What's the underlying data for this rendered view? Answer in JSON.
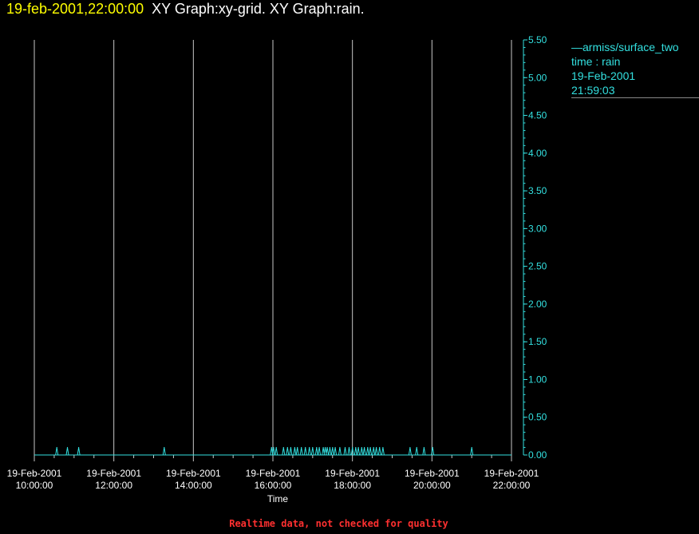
{
  "header": {
    "timestamp": "19-feb-2001,22:00:00",
    "graph_titles": "XY Graph:xy-grid.  XY Graph:rain."
  },
  "legend": {
    "series": "armiss/surface_two",
    "variable": "time : rain",
    "date": "19-Feb-2001",
    "time": "21:59:03"
  },
  "footer": "Realtime data, not checked for quality",
  "colors": {
    "series": "#33e0e0",
    "grid": "#c8c8c8",
    "axis_text": "#ffffff",
    "timestamp": "#ffff00",
    "footer": "#ff3030"
  },
  "chart_data": {
    "type": "line",
    "title": "",
    "xlabel": "Time",
    "ylabel": "",
    "x_range_hours": [
      10,
      22
    ],
    "ylim": [
      0,
      5.5
    ],
    "x_ticks": [
      {
        "hour": 10,
        "date": "19-Feb-2001",
        "time": "10:00:00"
      },
      {
        "hour": 12,
        "date": "19-Feb-2001",
        "time": "12:00:00"
      },
      {
        "hour": 14,
        "date": "19-Feb-2001",
        "time": "14:00:00"
      },
      {
        "hour": 16,
        "date": "19-Feb-2001",
        "time": "16:00:00"
      },
      {
        "hour": 18,
        "date": "19-Feb-2001",
        "time": "18:00:00"
      },
      {
        "hour": 20,
        "date": "19-Feb-2001",
        "time": "20:00:00"
      },
      {
        "hour": 22,
        "date": "19-Feb-2001",
        "time": "22:00:00"
      }
    ],
    "y_ticks": [
      "0.00",
      "0.50",
      "1.00",
      "1.50",
      "2.00",
      "2.50",
      "3.00",
      "3.50",
      "4.00",
      "4.50",
      "5.00",
      "5.50"
    ],
    "grid": "vertical",
    "legend_position": "top-right",
    "series": [
      {
        "name": "armiss/surface_two",
        "baseline": 0,
        "pulse_value": 0.1,
        "pulse_times": [
          "10:34",
          "10:50",
          "11:07",
          "13:16",
          "15:58",
          "16:01",
          "16:05",
          "16:16",
          "16:22",
          "16:27",
          "16:33",
          "16:37",
          "16:43",
          "16:49",
          "16:55",
          "17:00",
          "17:06",
          "17:10",
          "17:16",
          "17:19",
          "17:22",
          "17:26",
          "17:30",
          "17:34",
          "17:41",
          "17:49",
          "17:55",
          "18:00",
          "18:05",
          "18:09",
          "18:14",
          "18:18",
          "18:23",
          "18:27",
          "18:32",
          "18:36",
          "18:41",
          "18:46",
          "19:27",
          "19:37",
          "19:48",
          "20:01",
          "21:00"
        ]
      }
    ]
  }
}
